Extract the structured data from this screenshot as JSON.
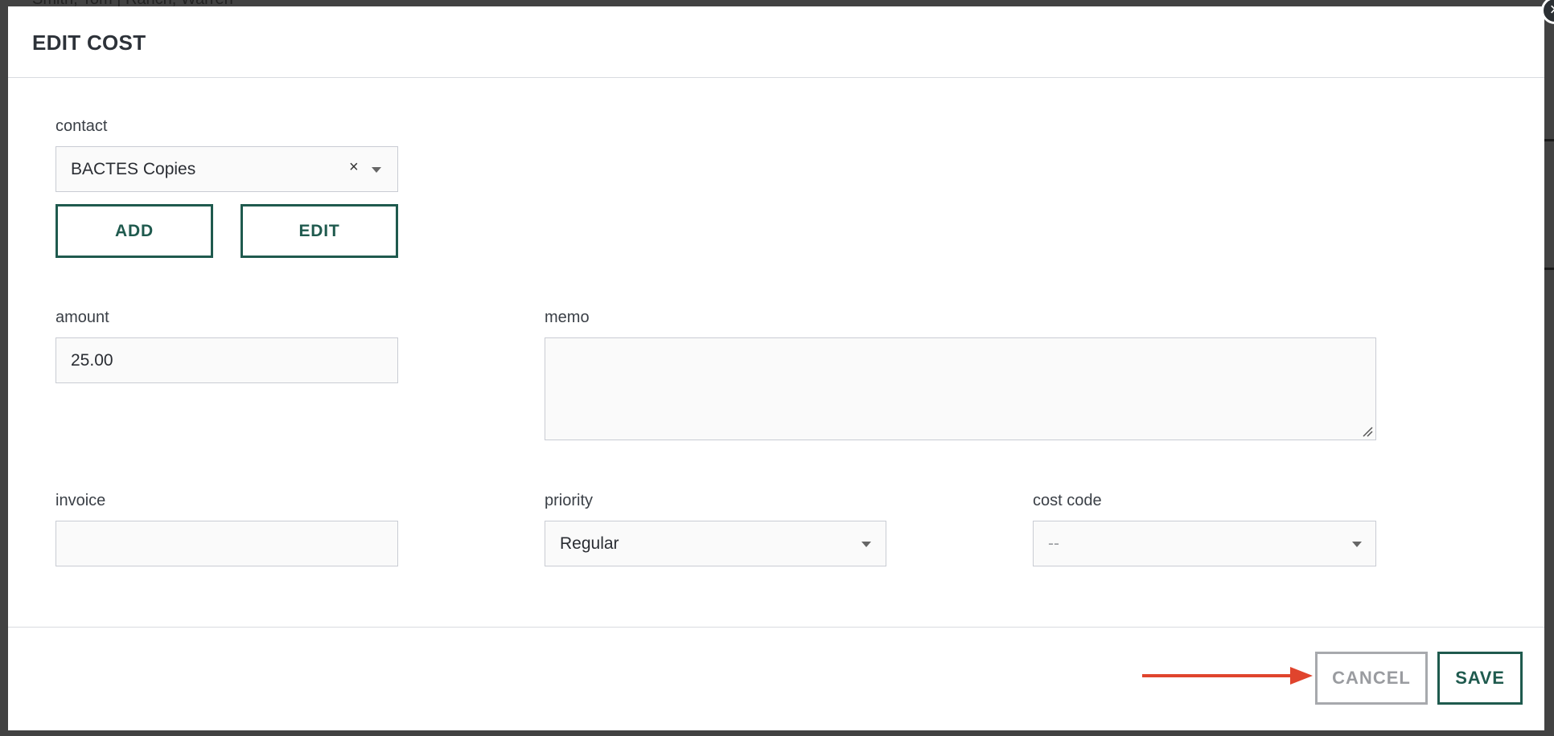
{
  "background": {
    "partial_text": "Smith, Tom  |  Ranch, Warren"
  },
  "modal": {
    "title": "EDIT COST",
    "close_icon": "close-icon"
  },
  "form": {
    "contact": {
      "label": "contact",
      "value": "BACTES Copies",
      "clear_symbol": "×",
      "add_label": "ADD",
      "edit_label": "EDIT"
    },
    "amount": {
      "label": "amount",
      "value": "25.00"
    },
    "memo": {
      "label": "memo",
      "value": ""
    },
    "invoice": {
      "label": "invoice",
      "value": ""
    },
    "priority": {
      "label": "priority",
      "value": "Regular"
    },
    "cost_code": {
      "label": "cost code",
      "value": "--"
    }
  },
  "footer": {
    "cancel_label": "CANCEL",
    "save_label": "SAVE"
  },
  "annotation": {
    "arrow_color": "#e0442d"
  },
  "colors": {
    "brand_green": "#1f5a4e",
    "disabled_gray": "#a7a9ad"
  }
}
